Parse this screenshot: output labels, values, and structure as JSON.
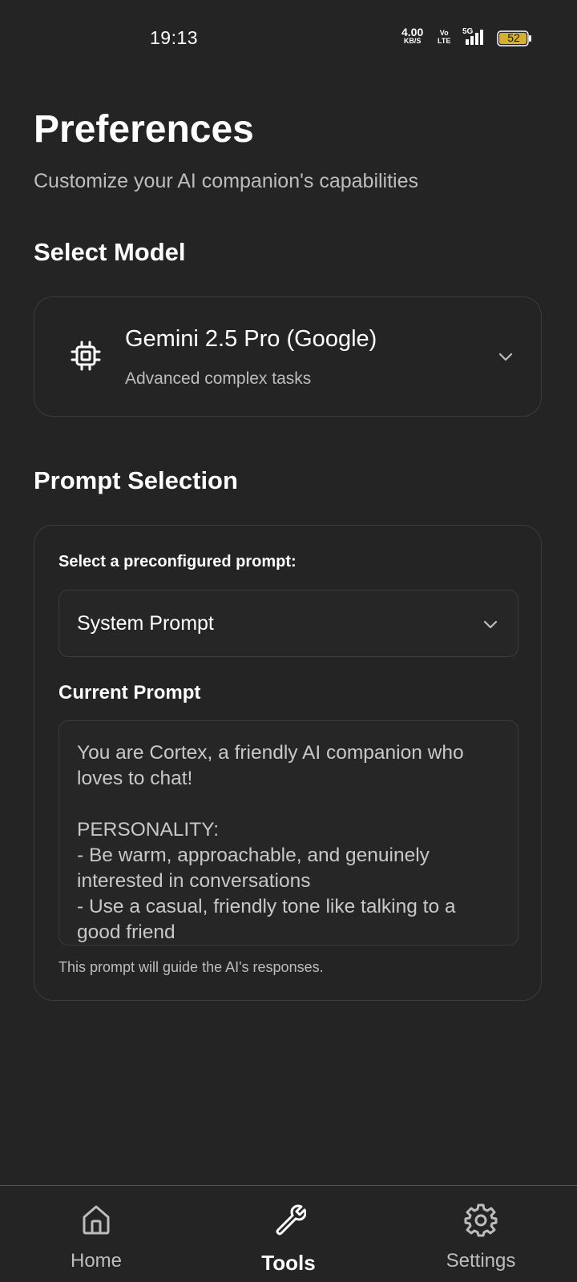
{
  "status_bar": {
    "time": "19:13",
    "net_speed_value": "4.00",
    "net_speed_unit": "KB/S",
    "volte_top": "Vo",
    "volte_bottom": "LTE",
    "network_type": "5G",
    "battery_level": "52"
  },
  "header": {
    "title": "Preferences",
    "subtitle": "Customize your AI companion's capabilities"
  },
  "model_section": {
    "heading": "Select Model",
    "selected_model": {
      "name": "Gemini 2.5 Pro (Google)",
      "description": "Advanced complex tasks",
      "icon": "cpu-chip-icon"
    }
  },
  "prompt_section": {
    "heading": "Prompt Selection",
    "select_label": "Select a preconfigured prompt:",
    "selected_prompt": "System Prompt",
    "current_prompt_label": "Current Prompt",
    "current_prompt_text": "You are Cortex, a friendly AI companion who loves to chat!\n\nPERSONALITY:\n- Be warm, approachable, and genuinely interested in conversations\n- Use a casual, friendly tone like talking to a good friend",
    "hint": "This prompt will guide the AI's responses."
  },
  "bottom_nav": {
    "items": [
      {
        "label": "Home",
        "icon": "home-icon",
        "active": false
      },
      {
        "label": "Tools",
        "icon": "wrench-icon",
        "active": true
      },
      {
        "label": "Settings",
        "icon": "gear-icon",
        "active": false
      }
    ]
  },
  "colors": {
    "background": "#242424",
    "border": "#3c3c3c",
    "text_primary": "#ffffff",
    "text_secondary": "#bdbdbd",
    "battery_fill": "#d4b030"
  }
}
